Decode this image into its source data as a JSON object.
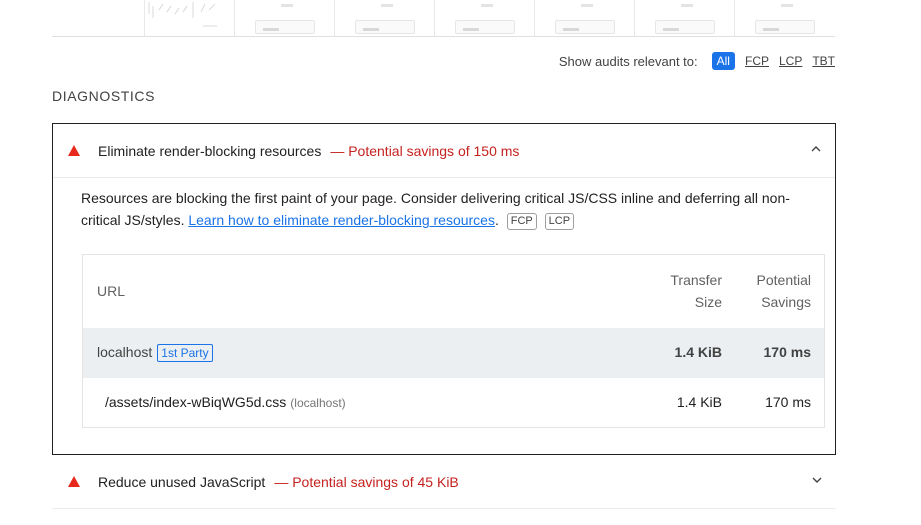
{
  "filter": {
    "label": "Show audits relevant to:",
    "chips": [
      "All",
      "FCP",
      "LCP",
      "TBT"
    ]
  },
  "section_title": "DIAGNOSTICS",
  "audit_open": {
    "title": "Eliminate render-blocking resources",
    "savings": "— Potential savings of 150 ms",
    "description_before": "Resources are blocking the first paint of your page. Consider delivering critical JS/CSS inline and deferring all non-critical JS/styles. ",
    "link_text": "Learn how to eliminate render-blocking resources",
    "description_after": ".",
    "tags": [
      "FCP",
      "LCP"
    ],
    "table": {
      "headers": {
        "url": "URL",
        "size_line1": "Transfer",
        "size_line2": "Size",
        "save_line1": "Potential",
        "save_line2": "Savings"
      },
      "group": {
        "name": "localhost",
        "badge": "1st Party",
        "size": "1.4 KiB",
        "savings": "170 ms"
      },
      "item": {
        "url": "/assets/index-wBiqWG5d.css",
        "host": "(localhost)",
        "size": "1.4 KiB",
        "savings": "170 ms"
      }
    }
  },
  "audit_closed": {
    "title": "Reduce unused JavaScript",
    "savings": "— Potential savings of 45 KiB"
  },
  "colors": {
    "accent": "#1a73e8",
    "warning": "#e8271d",
    "savings_text": "#c5221f"
  }
}
